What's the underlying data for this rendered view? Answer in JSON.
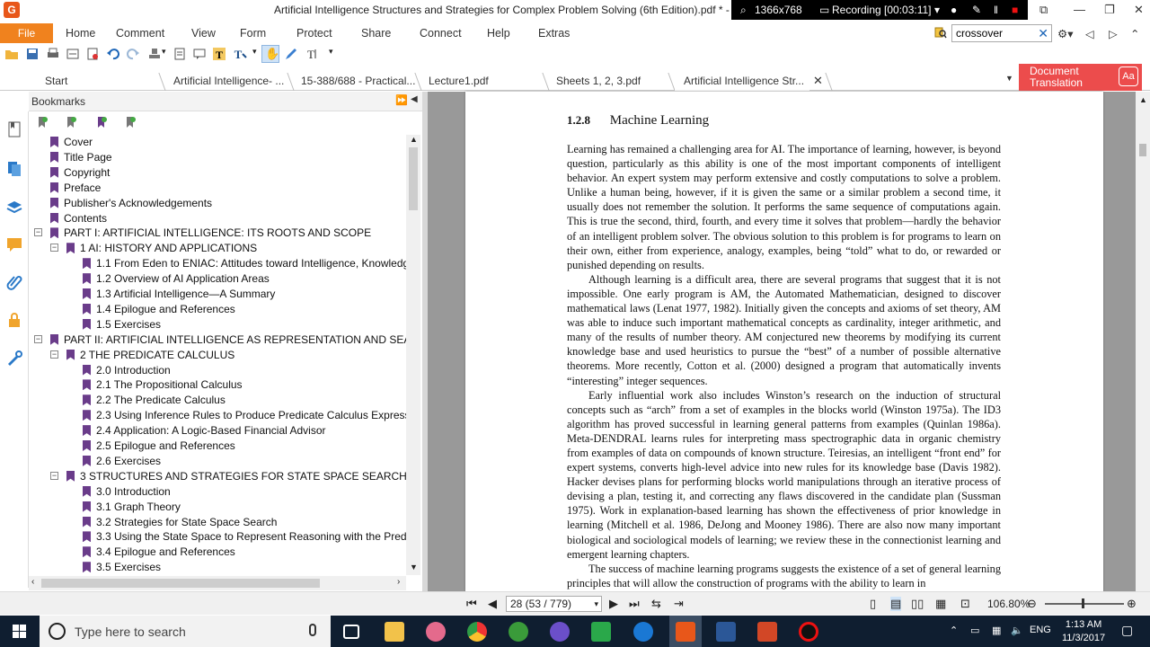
{
  "window": {
    "title": "Artificial Intelligence Structures and Strategies for Complex Problem Solving (6th Edition).pdf * - Fo",
    "recorder": {
      "resolution": "1366x768",
      "status": "Recording [00:03:11]"
    }
  },
  "menu": {
    "file": "File",
    "items": [
      "Home",
      "Comment",
      "View",
      "Form",
      "Protect",
      "Share",
      "Connect",
      "Help",
      "Extras"
    ]
  },
  "search": {
    "value": "crossover"
  },
  "tabs": [
    {
      "label": "Start"
    },
    {
      "label": "Artificial Intelligence- ..."
    },
    {
      "label": "15-388/688 - Practical..."
    },
    {
      "label": "Lecture1.pdf"
    },
    {
      "label": "Sheets 1, 2, 3.pdf"
    },
    {
      "label": "Artificial Intelligence Str..."
    }
  ],
  "doc_translation": {
    "line1": "Document",
    "line2": "Translation",
    "badge": "Aa"
  },
  "bookmarks": {
    "title": "Bookmarks",
    "items": [
      {
        "label": "Cover",
        "level": 0,
        "toggle": ""
      },
      {
        "label": "Title Page",
        "level": 0,
        "toggle": ""
      },
      {
        "label": "Copyright",
        "level": 0,
        "toggle": ""
      },
      {
        "label": "Preface",
        "level": 0,
        "toggle": ""
      },
      {
        "label": "Publisher's Acknowledgements",
        "level": 0,
        "toggle": ""
      },
      {
        "label": "Contents",
        "level": 0,
        "toggle": ""
      },
      {
        "label": "PART I: ARTIFICIAL INTELLIGENCE: ITS ROOTS AND SCOPE",
        "level": 0,
        "toggle": "−"
      },
      {
        "label": "1 AI: HISTORY AND APPLICATIONS",
        "level": 1,
        "toggle": "−"
      },
      {
        "label": "1.1 From Eden to ENIAC: Attitudes toward Intelligence, Knowledg",
        "level": 2,
        "toggle": ""
      },
      {
        "label": "1.2 Overview of AI Application Areas",
        "level": 2,
        "toggle": ""
      },
      {
        "label": "1.3 Artificial Intelligence—A Summary",
        "level": 2,
        "toggle": ""
      },
      {
        "label": "1.4 Epilogue and References",
        "level": 2,
        "toggle": ""
      },
      {
        "label": "1.5 Exercises",
        "level": 2,
        "toggle": ""
      },
      {
        "label": "PART II: ARTIFICIAL INTELLIGENCE AS REPRESENTATION AND SEARCH",
        "level": 0,
        "toggle": "−"
      },
      {
        "label": "2 THE PREDICATE CALCULUS",
        "level": 1,
        "toggle": "−"
      },
      {
        "label": "2.0 Introduction",
        "level": 2,
        "toggle": ""
      },
      {
        "label": "2.1 The Propositional Calculus",
        "level": 2,
        "toggle": ""
      },
      {
        "label": "2.2 The Predicate Calculus",
        "level": 2,
        "toggle": ""
      },
      {
        "label": "2.3 Using Inference Rules to Produce Predicate Calculus Expression",
        "level": 2,
        "toggle": ""
      },
      {
        "label": "2.4 Application: A Logic-Based Financial Advisor",
        "level": 2,
        "toggle": ""
      },
      {
        "label": "2.5 Epilogue and References",
        "level": 2,
        "toggle": ""
      },
      {
        "label": "2.6 Exercises",
        "level": 2,
        "toggle": ""
      },
      {
        "label": "3 STRUCTURES AND STRATEGIES FOR STATE SPACE SEARCH",
        "level": 1,
        "toggle": "−"
      },
      {
        "label": "3.0 Introduction",
        "level": 2,
        "toggle": ""
      },
      {
        "label": "3.1 Graph Theory",
        "level": 2,
        "toggle": ""
      },
      {
        "label": "3.2 Strategies for State Space Search",
        "level": 2,
        "toggle": ""
      },
      {
        "label": "3.3 Using the State Space to Represent Reasoning with the Predic",
        "level": 2,
        "toggle": ""
      },
      {
        "label": "3.4 Epilogue and References",
        "level": 2,
        "toggle": ""
      },
      {
        "label": "3.5 Exercises",
        "level": 2,
        "toggle": ""
      }
    ]
  },
  "document": {
    "section_number": "1.2.8",
    "section_title": "Machine Learning",
    "paragraphs": [
      "Learning has remained a challenging area for AI. The importance of learning, however, is beyond question, particularly as this ability is one of the most important components of intelligent behavior. An expert system may perform extensive and costly computations to solve a problem. Unlike a human being, however, if it is given the same or a similar problem a second time, it usually does not remember the solution. It performs the same sequence of computations again. This is true the second, third, fourth, and every time it solves that problem—hardly the behavior of an intelligent problem solver. The obvious solution to this problem is for programs to learn on their own, either from experience, analogy, examples, being “told” what to do, or rewarded or punished depending on results.",
      "Although learning is a difficult area, there are several programs that suggest that it is not impossible. One early program is AM, the Automated Mathematician, designed to discover mathematical laws (Lenat 1977, 1982). Initially given the concepts and axioms of set theory, AM was able to induce such important mathematical concepts as cardinality, integer arithmetic, and many of the results of number theory. AM conjectured new theorems by modifying its current knowledge base and used heuristics to pursue the “best” of a number of possible alternative theorems. More recently, Cotton et al. (2000) designed a program that automatically invents “interesting” integer sequences.",
      "Early influential work also includes Winston’s research on the induction of structural concepts such as “arch” from a set of examples in the blocks world (Winston 1975a). The ID3 algorithm has proved successful in learning general patterns from examples (Quinlan 1986a). Meta-DENDRAL learns rules for interpreting mass spectrographic data in organic chemistry from examples of data on compounds of known structure. Teiresias, an intelligent “front end” for expert systems, converts high-level advice into new rules for its knowledge base (Davis 1982). Hacker devises plans for performing blocks world manipulations through an iterative process of devising a plan, testing it, and correcting any flaws discovered in the candidate plan (Sussman 1975). Work in explanation-based learning has shown the effectiveness of prior knowledge in learning (Mitchell et al. 1986, DeJong and Mooney 1986). There are also now many important biological and sociological models of learning; we review these in the connectionist learning and emergent learning chapters.",
      "The success of machine learning programs suggests the existence of a set of general learning principles that will allow the construction of programs with the ability to learn in"
    ]
  },
  "status": {
    "page": "28 (53 / 779)",
    "zoom": "106.80%"
  },
  "taskbar": {
    "search_placeholder": "Type here to search",
    "lang": "ENG",
    "time": "1:13 AM",
    "date": "11/3/2017"
  }
}
